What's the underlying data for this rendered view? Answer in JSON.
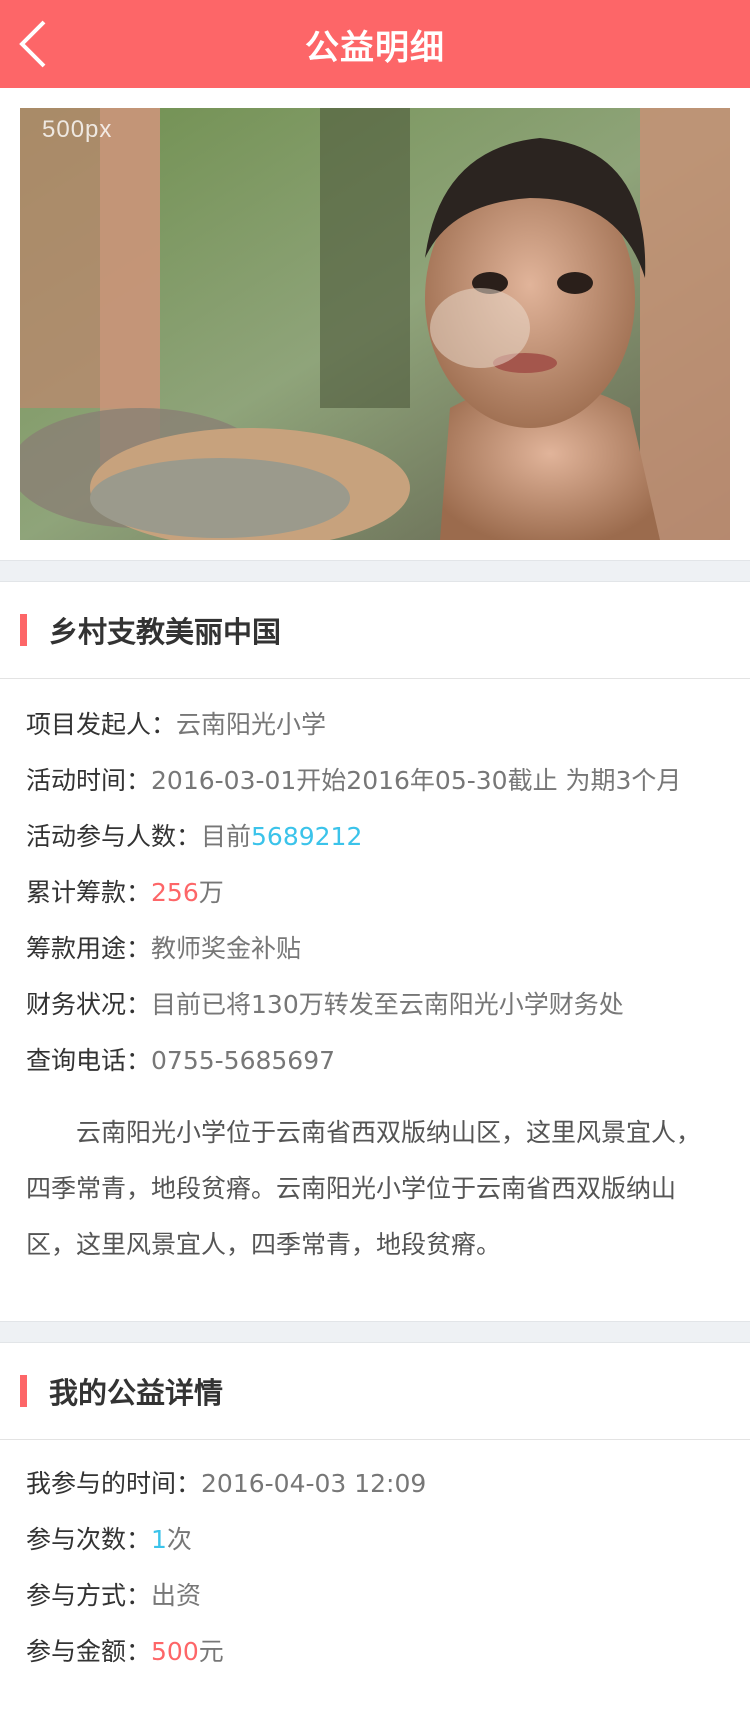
{
  "header": {
    "title": "公益明细"
  },
  "hero": {
    "watermark": "500px"
  },
  "project": {
    "title": "乡村支教美丽中国",
    "rows": [
      {
        "label": "项目发起人：",
        "value": "云南阳光小学"
      },
      {
        "label": "活动时间：",
        "value": "2016-03-01开始2016年05-30截止 为期3个月"
      },
      {
        "label": "活动参与人数：",
        "prefix": "目前",
        "highlight": "5689212"
      },
      {
        "label": "累计筹款：",
        "highlight": "256",
        "suffix": "万"
      },
      {
        "label": "筹款用途：",
        "value": "教师奖金补贴"
      },
      {
        "label": "财务状况：",
        "value": "目前已将130万转发至云南阳光小学财务处"
      },
      {
        "label": "查询电话：",
        "value": "0755-5685697"
      }
    ],
    "description": "云南阳光小学位于云南省西双版纳山区，这里风景宜人，四季常青，地段贫瘠。云南阳光小学位于云南省西双版纳山区，这里风景宜人，四季常青，地段贫瘠。"
  },
  "mine": {
    "title": "我的公益详情",
    "rows": [
      {
        "label": "我参与的时间：",
        "value": "2016-04-03 12:09"
      },
      {
        "label": "参与次数：",
        "highlight": "1",
        "suffix": "次"
      },
      {
        "label": "参与方式：",
        "value": "出资"
      },
      {
        "label": "参与金额：",
        "highlight": "500",
        "suffix": "元"
      }
    ]
  },
  "colors": {
    "accent": "#fd6668",
    "blue": "#3bc3ea"
  }
}
